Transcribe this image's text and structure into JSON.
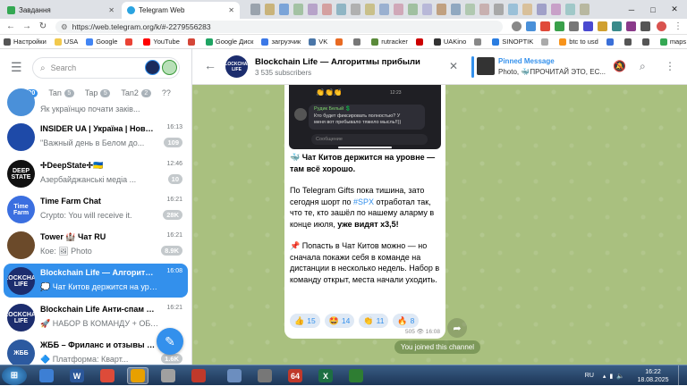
{
  "browser": {
    "tabs": [
      {
        "title": "Завдання",
        "icon_color": "#34a853"
      },
      {
        "title": "Telegram Web",
        "icon_color": "#2aa3e0",
        "active": true
      }
    ],
    "url": "https://web.telegram.org/k/#-2279556283",
    "bookmarks": [
      {
        "label": "Настройки",
        "color": "#555"
      },
      {
        "label": "USA",
        "color": "#f2c94c"
      },
      {
        "label": "Google",
        "color": "#4285f4"
      },
      {
        "label": "",
        "color": "#ea4335"
      },
      {
        "label": "YouTube",
        "color": "#ff0000"
      },
      {
        "label": "",
        "color": "#d44638"
      },
      {
        "label": "Google Диск",
        "color": "#1fa463"
      },
      {
        "label": "загрузчик",
        "color": "#3b78e7"
      },
      {
        "label": "VK",
        "color": "#4a76a8"
      },
      {
        "label": "",
        "color": "#e86a22"
      },
      {
        "label": "",
        "color": "#777"
      },
      {
        "label": "rutracker",
        "color": "#5a8a3a"
      },
      {
        "label": "",
        "color": "#cc0000"
      },
      {
        "label": "UAKino",
        "color": "#333"
      },
      {
        "label": "",
        "color": "#888"
      },
      {
        "label": "SINOPTIK",
        "color": "#2a7de1"
      },
      {
        "label": "",
        "color": "#aaa"
      },
      {
        "label": "btc to usd",
        "color": "#f7931a"
      },
      {
        "label": "",
        "color": "#3a6fd8"
      },
      {
        "label": "",
        "color": "#555"
      },
      {
        "label": "",
        "color": "#555"
      },
      {
        "label": "maps",
        "color": "#34a853"
      },
      {
        "label": "Другие закладки",
        "color": "#f2c94c"
      }
    ]
  },
  "sidebar": {
    "search_placeholder": "Search",
    "folders": [
      {
        "label": "All",
        "count": "20",
        "active": true
      },
      {
        "label": "Tan",
        "count": "5"
      },
      {
        "label": "Tap",
        "count": "5"
      },
      {
        "label": "Tan2",
        "count": "2"
      },
      {
        "label": "??",
        "count": ""
      }
    ],
    "chats": [
      {
        "name": "",
        "time": "",
        "preview": "Як українцю почати заків...",
        "badge": "",
        "avatar_text": "",
        "avatar_color": "#4a90d9"
      },
      {
        "name": "INSIDER UA | Україна | Новини",
        "time": "16:13",
        "preview": "\"Важный день в Белом до...",
        "badge": "109",
        "avatar_text": "",
        "avatar_color": "#1e4aa8"
      },
      {
        "name": "✢DeepState✢🇺🇦",
        "time": "12:46",
        "preview": "Азербайджанські медіа ...",
        "badge": "10",
        "avatar_text": "DEEP STATE",
        "avatar_color": "#111111"
      },
      {
        "name": "Time Farm Chat",
        "time": "16:21",
        "preview": "Crypto: You will receive it.",
        "badge": "28K",
        "avatar_text": "Time Farm",
        "avatar_color": "#3b6fe0"
      },
      {
        "name": "Tower 🏰 Чат RU",
        "time": "16:21",
        "preview": "Кое: 🖼 Photo",
        "badge": "8.9K",
        "avatar_text": "",
        "avatar_color": "#6b4a2a"
      },
      {
        "name": "Blockchain Life — Алгоритм...",
        "time": "16:08",
        "preview": "💭 Чат Китов держится на уров...",
        "badge": "",
        "avatar_text": "BLOCKCHAIN LIFE",
        "avatar_color": "#1c2d6e",
        "selected": true
      },
      {
        "name": "Blockchain Life Анти-спам бот🤖",
        "time": "16:21",
        "preview": "🚀 НАБОР В КОМАНДУ + ОБУЧЕ...",
        "badge": "",
        "avatar_text": "BLOCKCHAIN LIFE",
        "avatar_color": "#1c2d6e"
      },
      {
        "name": "ЖББ – Фриланс и отзывы з...",
        "time": "",
        "preview": "🔷 Платформа: Кварт...",
        "badge": "1.6K",
        "avatar_text": "ЖББ",
        "avatar_color": "#2c5aa0"
      }
    ],
    "fab_icon": "pencil-icon"
  },
  "channel": {
    "title": "Blockchain Life — Алгоритмы прибыли",
    "subscribers": "3 535 subscribers",
    "avatar_text": "BLOCKCHAIN LIFE",
    "pinned_title": "Pinned Message",
    "pinned_text": "Photo, 🐳ПРОЧИТАЙ ЭТО, ЕС..."
  },
  "screenshot_in_message": {
    "reply_name": "Рудик Белый 💲",
    "reply_text": "Кто будет фиксировать полностью? У меня вот пребывало тяжело мысль!!))",
    "time": "12:23",
    "input_placeholder": "Сообщение"
  },
  "message": {
    "p1": "🐳 Чат Китов держится на уровне — там всё хорошо.",
    "p2_a": "По Telegram Gifts пока тишина, зато сегодня шорт по ",
    "p2_link": "#SPX",
    "p2_b": " отработал так, что те, кто зашёл по нашему аларму в конце июля, ",
    "p2_bold": "уже видят х3,5!",
    "p3": "📌 Попасть в Чат Китов можно — но сначала покажи себя в команде на дистанции в несколько недель. Набор в команду открыт, места начали уходить.",
    "reactions": [
      {
        "emoji": "👍",
        "count": "15"
      },
      {
        "emoji": "🤩",
        "count": "14"
      },
      {
        "emoji": "👏",
        "count": "11"
      },
      {
        "emoji": "🔥",
        "count": "8"
      }
    ],
    "views": "505",
    "time": "16:08",
    "service_text": "You joined this channel"
  },
  "taskbar": {
    "lang": "RU",
    "time": "16:22",
    "date": "18.08.2025",
    "apps": [
      {
        "label": "",
        "color": "#3d7fd4"
      },
      {
        "label": "W",
        "color": "#2b579a"
      },
      {
        "label": "",
        "color": "#dd4b39"
      },
      {
        "label": "",
        "color": "#e8a000"
      },
      {
        "label": "",
        "color": "#a0a0a0"
      },
      {
        "label": "",
        "color": "#c0392b"
      },
      {
        "label": "",
        "color": "#6c8ebf"
      },
      {
        "label": "",
        "color": "#777"
      },
      {
        "label": "64",
        "color": "#c0392b"
      },
      {
        "label": "X",
        "color": "#1d6f42"
      },
      {
        "label": "",
        "color": "#2e7d32"
      }
    ]
  }
}
